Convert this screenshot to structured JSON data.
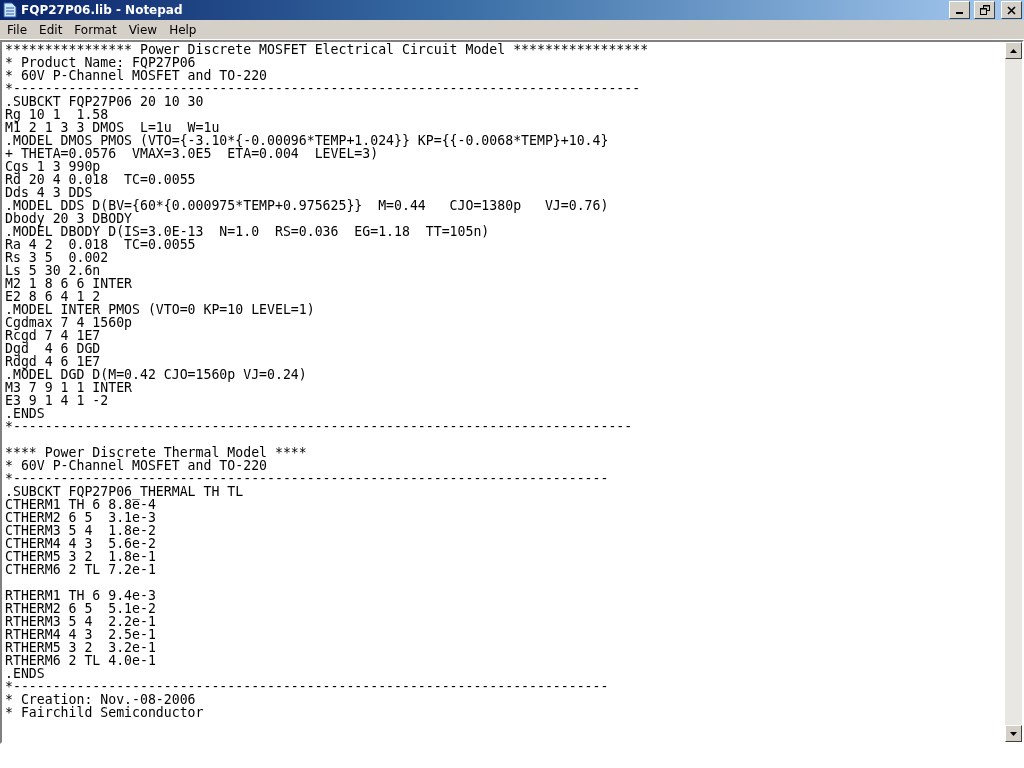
{
  "window": {
    "title": "FQP27P06.lib - Notepad"
  },
  "menu": [
    "File",
    "Edit",
    "Format",
    "View",
    "Help"
  ],
  "editor": {
    "text": "**************** Power Discrete MOSFET Electrical Circuit Model *****************\n* Product Name: FQP27P06\n* 60V P-Channel MOSFET and TO-220\n*-------------------------------------------------------------------------------\n.SUBCKT FQP27P06 20 10 30\nRg 10 1  1.58\nM1 2 1 3 3 DMOS  L=1u  W=1u\n.MODEL DMOS PMOS (VTO={-3.10*{-0.00096*TEMP+1.024}} KP={{-0.0068*TEMP}+10.4}\n+ THETA=0.0576  VMAX=3.0E5  ETA=0.004  LEVEL=3)\nCgs 1 3 990p\nRd 20 4 0.018  TC=0.0055\nDds 4 3 DDS\n.MODEL DDS D(BV={60*{0.000975*TEMP+0.975625}}  M=0.44   CJO=1380p   VJ=0.76)\nDbody 20 3 DBODY\n.MODEL DBODY D(IS=3.0E-13  N=1.0  RS=0.036  EG=1.18  TT=105n)\nRa 4 2  0.018  TC=0.0055\nRs 3 5  0.002\nLs 5 30 2.6n\nM2 1 8 6 6 INTER\nE2 8 6 4 1 2\n.MODEL INTER PMOS (VTO=0 KP=10 LEVEL=1)\nCgdmax 7 4 1560p\nRcgd 7 4 1E7\nDgd  4 6 DGD\nRdgd 4 6 1E7\n.MODEL DGD D(M=0.42 CJO=1560p VJ=0.24)\nM3 7 9 1 1 INTER\nE3 9 1 4 1 -2\n.ENDS\n*------------------------------------------------------------------------------\n\n**** Power Discrete Thermal Model ****\n* 60V P-Channel MOSFET and TO-220\n*---------------------------------------------------------------------------\n.SUBCKT FQP27P06_THERMAL TH TL\nCTHERM1 TH 6 8.8e-4\nCTHERM2 6 5  3.1e-3\nCTHERM3 5 4  1.8e-2\nCTHERM4 4 3  5.6e-2\nCTHERM5 3 2  1.8e-1\nCTHERM6 2 TL 7.2e-1\n\nRTHERM1 TH 6 9.4e-3\nRTHERM2 6 5  5.1e-2\nRTHERM3 5 4  2.2e-1\nRTHERM4 4 3  2.5e-1\nRTHERM5 3 2  3.2e-1\nRTHERM6 2 TL 4.0e-1\n.ENDS\n*---------------------------------------------------------------------------\n* Creation: Nov.-08-2006\n* Fairchild Semiconductor"
  }
}
